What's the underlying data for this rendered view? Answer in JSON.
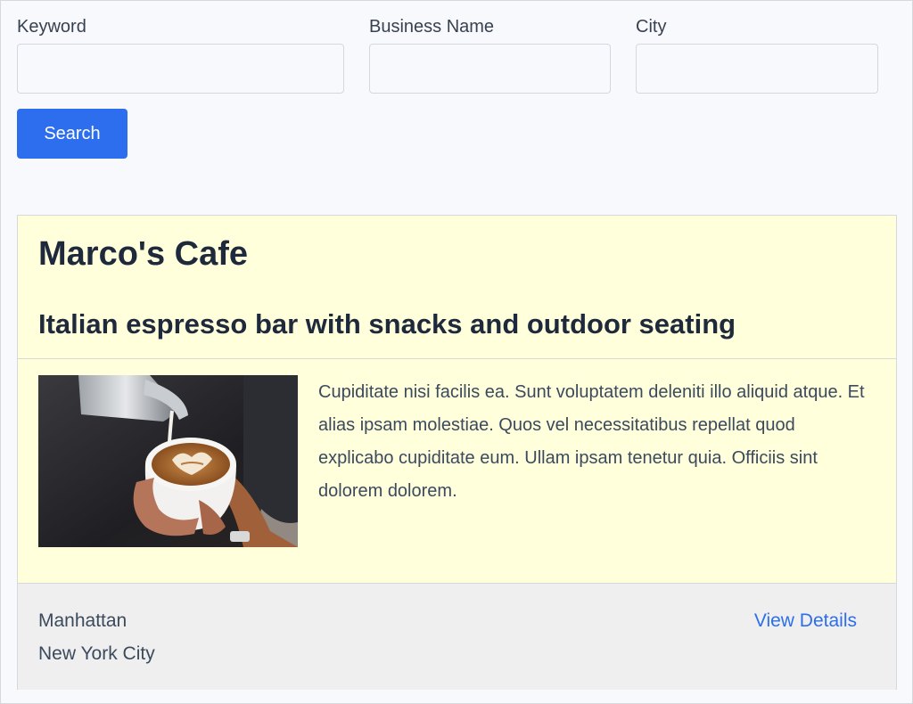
{
  "search_form": {
    "keyword_label": "Keyword",
    "keyword_value": "",
    "business_name_label": "Business Name",
    "business_name_value": "",
    "city_label": "City",
    "city_value": "",
    "search_button_label": "Search"
  },
  "listing": {
    "title": "Marco's Cafe",
    "subtitle": "Italian espresso bar with snacks and outdoor seating",
    "image_icon": "latte-art-photo",
    "description": "Cupiditate nisi facilis ea. Sunt voluptatem deleniti illo aliquid atque. Et alias ipsam molestiae. Quos vel necessitatibus repellat quod explicabo cupiditate eum. Ullam ipsam tenetur quia. Officiis sint dolorem dolorem.",
    "neighborhood": "Manhattan",
    "city": "New York City",
    "details_link_label": "View Details"
  },
  "colors": {
    "accent": "#2c6eed",
    "card_background": "#ffffdc",
    "footer_background": "#efefef"
  }
}
